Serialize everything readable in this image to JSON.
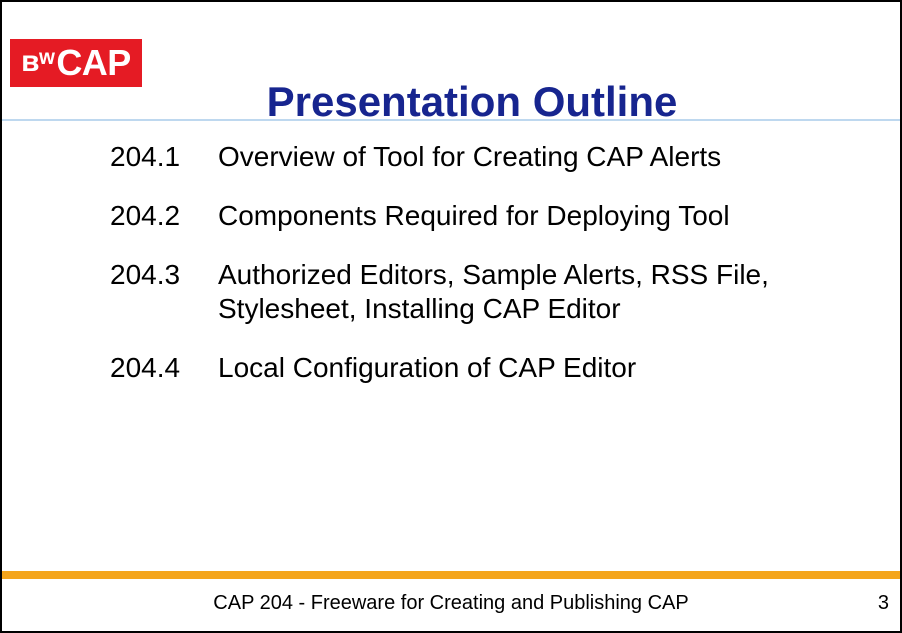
{
  "logo": {
    "mark": "ʙʷ",
    "text": "CAP",
    "color": "#e51b24"
  },
  "title": {
    "text": "Presentation Outline",
    "color": "#17258f",
    "rule_color": "#bed8ef"
  },
  "outline": {
    "items": [
      {
        "number": "204.1",
        "text": "Overview of Tool for Creating CAP Alerts"
      },
      {
        "number": "204.2",
        "text": "Components Required for Deploying Tool"
      },
      {
        "number": "204.3",
        "text": "Authorized Editors, Sample Alerts, RSS File,\nStylesheet, Installing CAP Editor"
      },
      {
        "number": "204.4",
        "text": "Local Configuration of CAP Editor"
      }
    ]
  },
  "footer": {
    "text": "CAP 204 - Freeware for Creating and Publishing CAP",
    "page_number": "3",
    "rule_color": "#f4a51c"
  }
}
